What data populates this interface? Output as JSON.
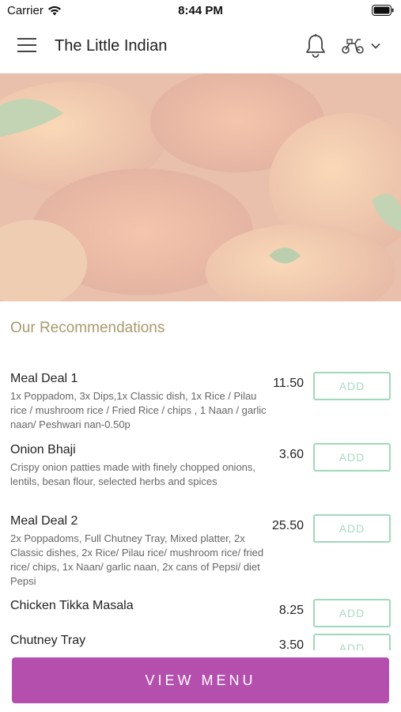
{
  "status_bar": {
    "carrier": "Carrier",
    "time": "8:44 PM"
  },
  "header": {
    "title": "The Little Indian",
    "icons": [
      "menu-icon",
      "bell-icon",
      "delivery-scooter-icon",
      "chevron-down-icon"
    ]
  },
  "section": {
    "title": "Our Recommendations"
  },
  "items": [
    {
      "name": "Meal Deal 1",
      "description": "1x Poppadom, 3x Dips,1x Classic dish, 1x Rice / Pilau rice / mushroom rice / Fried Rice / chips , 1 Naan / garlic naan/ Peshwari nan-0.50p",
      "price": "11.50",
      "add_label": "ADD"
    },
    {
      "name": "Onion Bhaji",
      "description": "Crispy onion patties made with finely chopped onions, lentils, besan flour, selected herbs and spices",
      "price": "3.60",
      "add_label": "ADD"
    },
    {
      "name": "Meal Deal 2",
      "description": "2x Poppadoms, Full Chutney Tray, Mixed platter, 2x Classic dishes, 2x Rice/ Pilau rice/ mushroom rice/ fried rice/ chips, 1x Naan/ garlic naan, 2x cans of Pepsi/ diet Pepsi",
      "price": "25.50",
      "add_label": "ADD"
    },
    {
      "name": "Chicken Tikka Masala",
      "description": "",
      "price": "8.25",
      "add_label": "ADD"
    },
    {
      "name": "Chutney Tray",
      "description": "",
      "price": "3.50",
      "add_label": "ADD"
    }
  ],
  "footer": {
    "view_menu_label": "VIEW MENU"
  },
  "colors": {
    "accent": "#b54fae",
    "section_title": "#a89a6d",
    "add_border": "#9fd9b8"
  }
}
